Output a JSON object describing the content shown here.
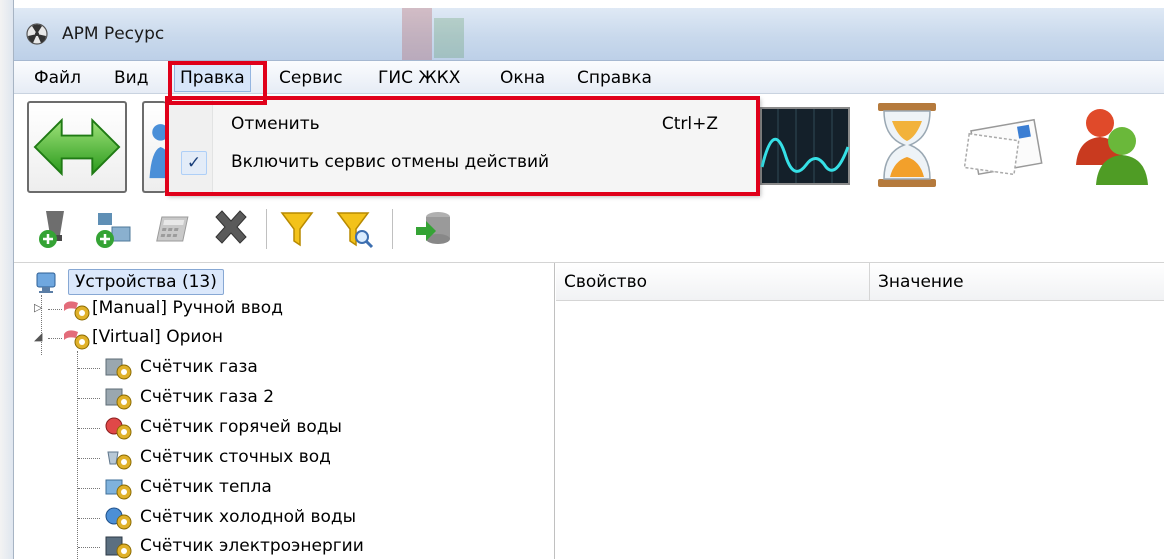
{
  "window": {
    "title": "АРМ Ресурс"
  },
  "menubar": {
    "items": [
      {
        "label": "Файл"
      },
      {
        "label": "Вид"
      },
      {
        "label": "Правка"
      },
      {
        "label": "Сервис"
      },
      {
        "label": "ГИС ЖКХ"
      },
      {
        "label": "Окна"
      },
      {
        "label": "Справка"
      }
    ]
  },
  "dropdown": {
    "items": [
      {
        "label": "Отменить",
        "shortcut": "Ctrl+Z"
      },
      {
        "label": "Включить сервис отмены действий",
        "check": "✓"
      }
    ]
  },
  "tree": {
    "root": "Устройства (13)",
    "nodes": [
      {
        "label": "[Manual] Ручной ввод"
      },
      {
        "label": "[Virtual] Орион"
      },
      {
        "label": "Счётчик газа"
      },
      {
        "label": "Счётчик газа 2"
      },
      {
        "label": "Счётчик горячей воды"
      },
      {
        "label": "Счётчик сточных вод"
      },
      {
        "label": "Счётчик тепла"
      },
      {
        "label": "Счётчик холодной воды"
      },
      {
        "label": "Счётчик электроэнергии"
      }
    ]
  },
  "grid": {
    "columns": [
      "Свойство",
      "Значение"
    ]
  },
  "colors": {
    "highlight": "#e0001a",
    "titlebar": "#c9d9ec"
  }
}
